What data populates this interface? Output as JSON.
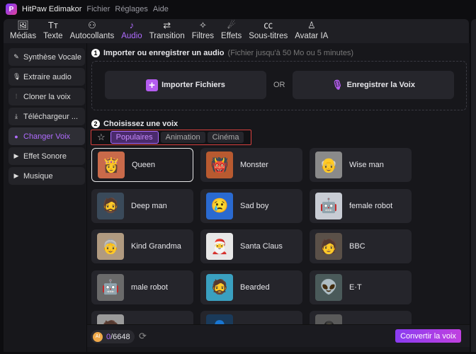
{
  "app": {
    "title": "HitPaw Edimakor",
    "menu": [
      "Fichier",
      "Réglages",
      "Aide"
    ]
  },
  "toolbar": [
    {
      "label": "Médias",
      "icon": "media-icon",
      "glyph": "🖼"
    },
    {
      "label": "Texte",
      "icon": "text-icon",
      "glyph": "Tт"
    },
    {
      "label": "Autocollants",
      "icon": "stickers-icon",
      "glyph": "⚇"
    },
    {
      "label": "Audio",
      "icon": "music-note-icon",
      "glyph": "♪",
      "active": true
    },
    {
      "label": "Transition",
      "icon": "transition-icon",
      "glyph": "⇄"
    },
    {
      "label": "Filtres",
      "icon": "sparkle-icon",
      "glyph": "✧"
    },
    {
      "label": "Effets",
      "icon": "effects-icon",
      "glyph": "☄"
    },
    {
      "label": "Sous-titres",
      "icon": "subtitles-icon",
      "glyph": "㏄"
    },
    {
      "label": "Avatar IA",
      "icon": "avatar-icon",
      "glyph": "♙"
    }
  ],
  "sidebar": [
    {
      "label": "Synthèse Vocale",
      "icon": "text-to-speech-icon",
      "glyph": "✎"
    },
    {
      "label": "Extraire audio",
      "icon": "microphone-icon",
      "glyph": "🎙"
    },
    {
      "label": "Cloner la voix",
      "icon": "waveform-icon",
      "glyph": "⫶"
    },
    {
      "label": "Téléchargeur ...",
      "icon": "download-icon",
      "glyph": "⤓"
    },
    {
      "label": "Changer Voix",
      "icon": "voice-change-icon",
      "glyph": "●",
      "active": true
    },
    {
      "label": "Effet Sonore",
      "icon": "triangle-right-icon",
      "glyph": "▶"
    },
    {
      "label": "Musique",
      "icon": "triangle-right-icon",
      "glyph": "▶"
    }
  ],
  "section1": {
    "num": "1",
    "title": "Importer ou enregistrer un audio",
    "hint": "(Fichier jusqu'à 50 Mo ou 5 minutes)",
    "import_label": "Importer Fichiers",
    "or_label": "OR",
    "record_label": "Enregistrer la Voix"
  },
  "section2": {
    "num": "2",
    "title": "Choisissez une voix",
    "tabs": [
      "Populaires",
      "Animation",
      "Cinéma"
    ],
    "active_tab": "Populaires"
  },
  "voices": [
    {
      "name": "Queen",
      "glyph": "👸",
      "bg": "#c96a4a",
      "selected": true
    },
    {
      "name": "Monster",
      "glyph": "👹",
      "bg": "#b85a30"
    },
    {
      "name": "Wise man",
      "glyph": "👴",
      "bg": "#8a8a8a"
    },
    {
      "name": "Deep man",
      "glyph": "🧔",
      "bg": "#3a4a5a"
    },
    {
      "name": "Sad boy",
      "glyph": "😢",
      "bg": "#2a6ad0"
    },
    {
      "name": "female robot",
      "glyph": "🤖",
      "bg": "#c8ccd4"
    },
    {
      "name": "Kind Grandma",
      "glyph": "👵",
      "bg": "#b09a80"
    },
    {
      "name": "Santa Claus",
      "glyph": "🎅",
      "bg": "#e8e8e8"
    },
    {
      "name": "BBC",
      "glyph": "🧑",
      "bg": "#5a5048"
    },
    {
      "name": "male robot",
      "glyph": "🤖",
      "bg": "#6a6a6a"
    },
    {
      "name": "Bearded",
      "glyph": "🧔",
      "bg": "#3aa0c0"
    },
    {
      "name": "E·T",
      "glyph": "👽",
      "bg": "#4a5a5a"
    },
    {
      "name": "",
      "glyph": "🧑",
      "bg": "#9a9a9a"
    },
    {
      "name": "",
      "glyph": "👤",
      "bg": "#1a3a5a"
    },
    {
      "name": "",
      "glyph": "🥷",
      "bg": "#5a5a5a"
    }
  ],
  "footer": {
    "credits_used": "0",
    "credits_total": "/6648",
    "convert_label": "Convertir la voix"
  },
  "colors": {
    "accent": "#b06cff",
    "highlight_border": "#d9413f"
  }
}
